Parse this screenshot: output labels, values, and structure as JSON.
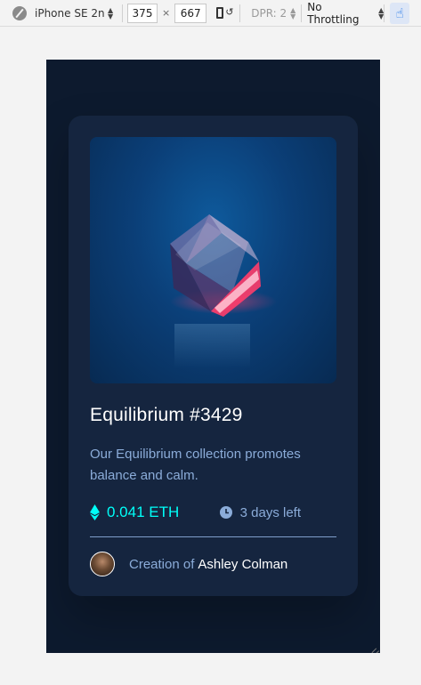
{
  "toolbar": {
    "device": "iPhone SE 2n...",
    "width": "375",
    "times": "×",
    "height": "667",
    "dpr": "DPR: 2",
    "throttling": "No Throttling"
  },
  "card": {
    "title": "Equilibrium #3429",
    "description": "Our Equilibrium collection promotes balance and calm.",
    "price": "0.041 ETH",
    "time_left": "3 days left",
    "creator_prefix": "Creation of",
    "creator_name": "Ashley Colman"
  },
  "colors": {
    "background": "#0d1a2e",
    "card": "#15253f",
    "accent_cyan": "#00fff8",
    "soft_blue": "#8bacd9",
    "white": "#ffffff"
  },
  "icons": [
    "compass-icon",
    "rotate-icon",
    "touch-icon",
    "ethereum-icon",
    "clock-icon",
    "avatar"
  ]
}
